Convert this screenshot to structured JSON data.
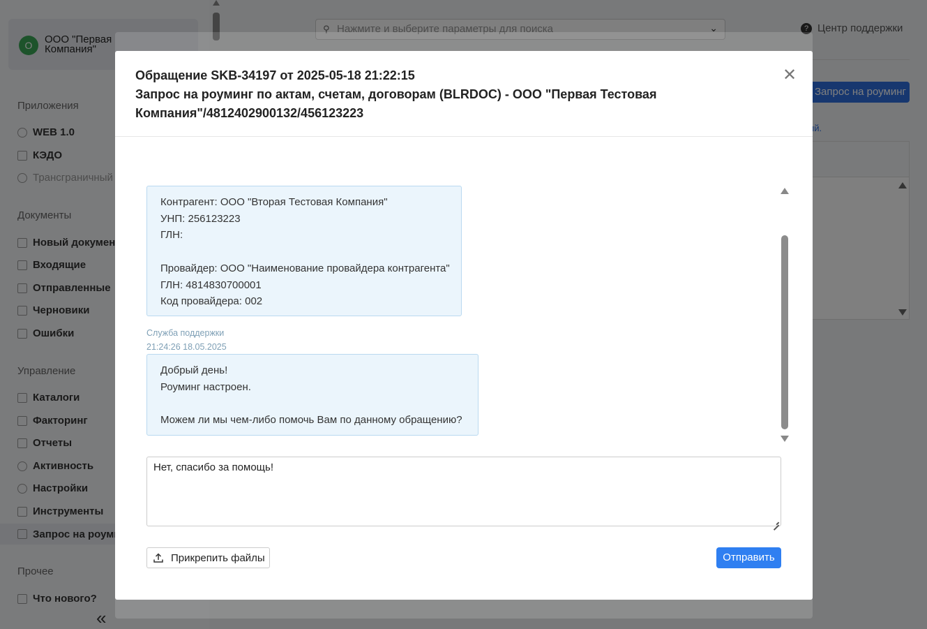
{
  "sidebar": {
    "company": {
      "avatar_letter": "О",
      "name": "ООО \"Первая Компания\""
    },
    "sections": {
      "apps": "Приложения",
      "documents": "Документы",
      "management": "Управление",
      "other": "Прочее"
    },
    "apps": [
      "WEB 1.0",
      "КЭДО",
      "Трансграничный"
    ],
    "documents": [
      "Новый документ",
      "Входящие",
      "Отправленные",
      "Черновики",
      "Ошибки"
    ],
    "management": [
      "Каталоги",
      "Факторинг",
      "Отчеты",
      "Активность",
      "Настройки",
      "Инструменты",
      "Запрос на роуминг"
    ],
    "other": [
      "Что нового?"
    ]
  },
  "header": {
    "search_placeholder": "Нажмите и выберите параметры для поиска",
    "support_label": "Центр поддержки"
  },
  "background": {
    "roaming_button": "Запрос на роуминг",
    "link_fragment": "ий."
  },
  "modal": {
    "title_line1": "Обращение SKB-34197 от 2025-05-18 21:22:15",
    "title_line2": "Запрос на роуминг по актам, счетам, договорам (BLRDOC) - ООО \"Первая Тестовая",
    "title_line3": "Компания\"/4812402900132/456123223",
    "messages": [
      {
        "lines": [
          "Контрагент: ООО \"Вторая Тестовая Компания\"",
          "УНП: 256123223",
          "ГЛН:",
          "",
          "Провайдер: ООО \"Наименование провайдера контрагента\"",
          "ГЛН: 4814830700001",
          "Код провайдера: 002"
        ]
      },
      {
        "author": "Служба поддержки",
        "timestamp": "21:24:26 18.05.2025",
        "lines": [
          "Добрый день!",
          "Роуминг настроен.",
          "",
          "Можем ли мы чем-либо помочь Вам по данному обращению?"
        ]
      }
    ],
    "reply_value": "Нет, спасибо за помощь!",
    "attach_label": "Прикрепить файлы",
    "send_label": "Отправить"
  },
  "colors": {
    "accent": "#2f7ff1",
    "bubble_bg": "#ebf5fc",
    "bubble_border": "#b9d9f0",
    "meta_text": "#7fa0b6"
  }
}
